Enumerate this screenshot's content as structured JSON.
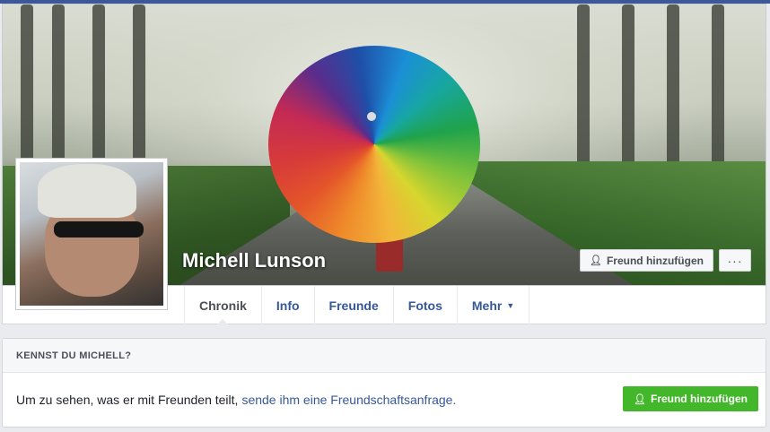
{
  "profile": {
    "name": "Michell Lunson",
    "add_friend_label": "Freund hinzufügen",
    "more_label": "···"
  },
  "tabs": [
    {
      "label": "Chronik"
    },
    {
      "label": "Info"
    },
    {
      "label": "Freunde"
    },
    {
      "label": "Fotos"
    },
    {
      "label": "Mehr",
      "caret": "▼"
    }
  ],
  "know_card": {
    "title": "KENNST DU MICHELL?",
    "text": "Um zu sehen, was er mit Freunden teilt,",
    "link": "sende ihm eine Freundschaftsanfrage.",
    "button_label": "Freund hinzufügen"
  },
  "icons": {
    "add_friend": "user-plus-icon"
  },
  "colors": {
    "brand": "#3b5998",
    "link": "#365899",
    "green": "#42b72a"
  }
}
